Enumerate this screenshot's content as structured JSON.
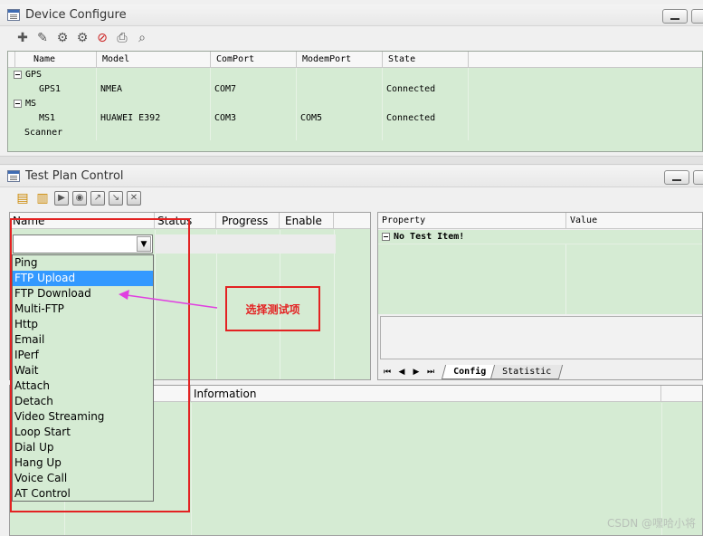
{
  "device_window": {
    "title": "Device Configure",
    "toolbar_icons": [
      "add-device-icon",
      "edit-device-icon",
      "connect-icon",
      "disconnect-icon",
      "delete-device-icon",
      "print-icon",
      "search-icon"
    ],
    "columns": [
      "Name",
      "Model",
      "ComPort",
      "ModemPort",
      "State"
    ],
    "rows": [
      {
        "name": "GPS",
        "model": "",
        "com": "",
        "modem": "",
        "state": "",
        "group": true
      },
      {
        "name": "GPS1",
        "model": "NMEA",
        "com": "COM7",
        "modem": "",
        "state": "Connected",
        "group": false
      },
      {
        "name": "MS",
        "model": "",
        "com": "",
        "modem": "",
        "state": "",
        "group": true
      },
      {
        "name": "MS1",
        "model": "HUAWEI E392",
        "com": "COM3",
        "modem": "COM5",
        "state": "Connected",
        "group": false
      },
      {
        "name": "Scanner",
        "model": "",
        "com": "",
        "modem": "",
        "state": "",
        "group": false
      }
    ]
  },
  "testplan_window": {
    "title": "Test Plan Control",
    "toolbar_icons": [
      "new-plan-icon",
      "open-plan-icon",
      "start-icon",
      "stop-icon",
      "import-icon",
      "export-icon",
      "clear-icon"
    ],
    "columns": [
      "Name",
      "Status",
      "Progress",
      "Enable"
    ],
    "dropdown_items": [
      "Ping",
      "FTP Upload",
      "FTP Download",
      "Multi-FTP",
      "Http",
      "Email",
      "IPerf",
      "Wait",
      "Attach",
      "Detach",
      "Video Streaming",
      "Loop Start",
      "Dial Up",
      "Hang Up",
      "Voice Call",
      "AT Control"
    ],
    "selected_item": "FTP Upload"
  },
  "property_panel": {
    "columns": [
      "Property",
      "Value"
    ],
    "empty_text": "No Test Item!",
    "tabs": [
      "Config",
      "Statistic"
    ],
    "active_tab": "Config"
  },
  "info_panel": {
    "columns": [
      "",
      "Information"
    ]
  },
  "annotation": {
    "label": "选择测试项"
  },
  "watermark": "CSDN @嘿哈小将",
  "colors": {
    "grid_green": "#d5ebd3",
    "selection_blue": "#3399ff",
    "annotation_red": "#e32222",
    "arrow_magenta": "#e040e0"
  }
}
